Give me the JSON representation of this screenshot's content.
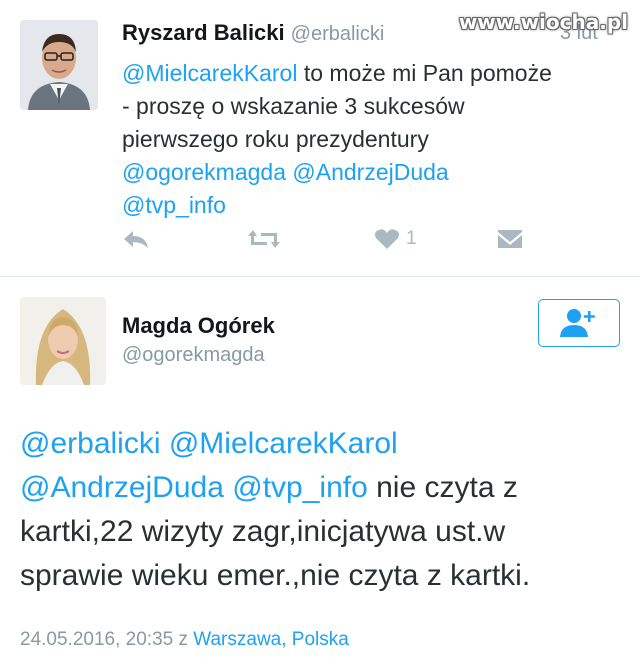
{
  "watermark": "www.wiocha.pl",
  "tweet1": {
    "name": "Ryszard Balicki",
    "handle": "@erbalicki",
    "time": "3 lut",
    "mention1": "@MielcarekKarol",
    "line1_rest": " to może mi Pan pomoże",
    "line2": "- proszę o wskazanie 3 sukcesów",
    "line3": "pierwszego roku prezydentury",
    "mention2": "@ogorekmagda",
    "mention3": "@AndrzejDuda",
    "mention4": "@tvp_info",
    "like_count": "1",
    "icons": [
      "reply-icon",
      "retweet-icon",
      "heart-icon",
      "message-icon"
    ]
  },
  "tweet2": {
    "name": "Magda Ogórek",
    "handle": "@ogorekmagda",
    "follow_icon": "add-user-icon",
    "mention1": "@erbalicki",
    "mention2": "@MielcarekKarol",
    "mention3": "@AndrzejDuda",
    "mention4": "@tvp_info",
    "text_after_mentions": " nie czyta z",
    "line3": "kartki,22 wizyty zagr,inicjatywa ust.w",
    "line4": "sprawie wieku emer.,nie czyta z kartki.",
    "date": "24.05.2016, 20:35",
    "date_sep": " z ",
    "location": "Warszawa, Polska"
  },
  "colors": {
    "accent": "#1da1f2",
    "muted": "#8899a6",
    "icon": "#aab8c2"
  }
}
